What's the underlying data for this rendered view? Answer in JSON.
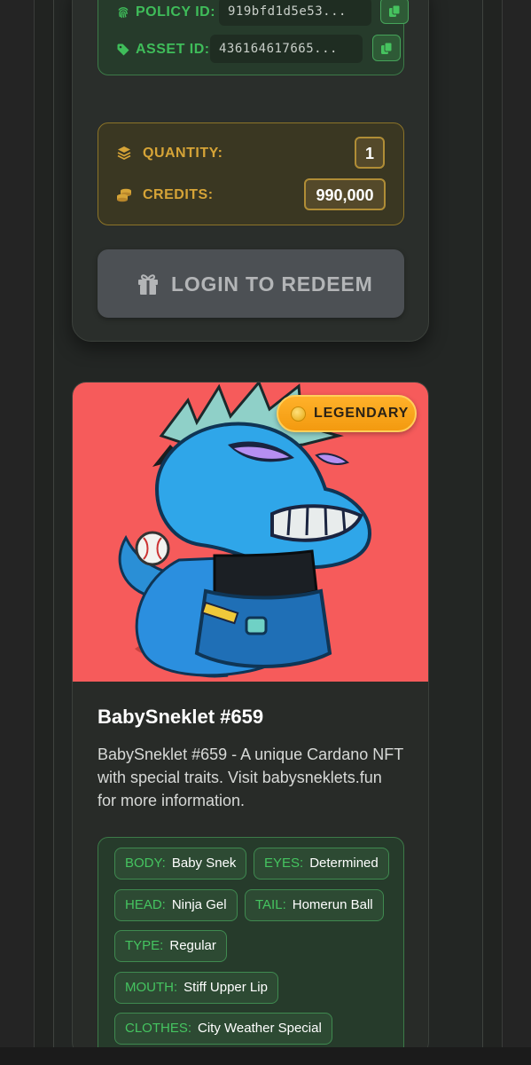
{
  "colors": {
    "accent_green": "#3fbd5a",
    "accent_gold": "#d6a437",
    "rarity_orange": "#ffb12a",
    "image_background": "#f65b5b"
  },
  "asset_ids": {
    "policy_label": "POLICY ID:",
    "policy_value": "919bfd1d5e53...",
    "asset_label": "ASSET ID:",
    "asset_value": "436164617665..."
  },
  "redeem_info": {
    "quantity_label": "QUANTITY:",
    "quantity_value": "1",
    "credits_label": "CREDITS:",
    "credits_value": "990,000"
  },
  "redeem_button": {
    "label": "LOGIN TO REDEEM",
    "icon": "gift-icon"
  },
  "nft": {
    "rarity": "LEGENDARY",
    "title": "BabySneklet #659",
    "description": "BabySneklet #659 - A unique Cardano NFT with special traits. Visit babysneklets.fun for more information.",
    "traits": [
      {
        "key": "BODY:",
        "value": "Baby Snek"
      },
      {
        "key": "EYES:",
        "value": "Determined"
      },
      {
        "key": "HEAD:",
        "value": "Ninja Gel"
      },
      {
        "key": "TAIL:",
        "value": "Homerun Ball"
      },
      {
        "key": "TYPE:",
        "value": "Regular"
      },
      {
        "key": "MOUTH:",
        "value": "Stiff Upper Lip"
      },
      {
        "key": "CLOTHES:",
        "value": "City Weather Special"
      }
    ]
  }
}
